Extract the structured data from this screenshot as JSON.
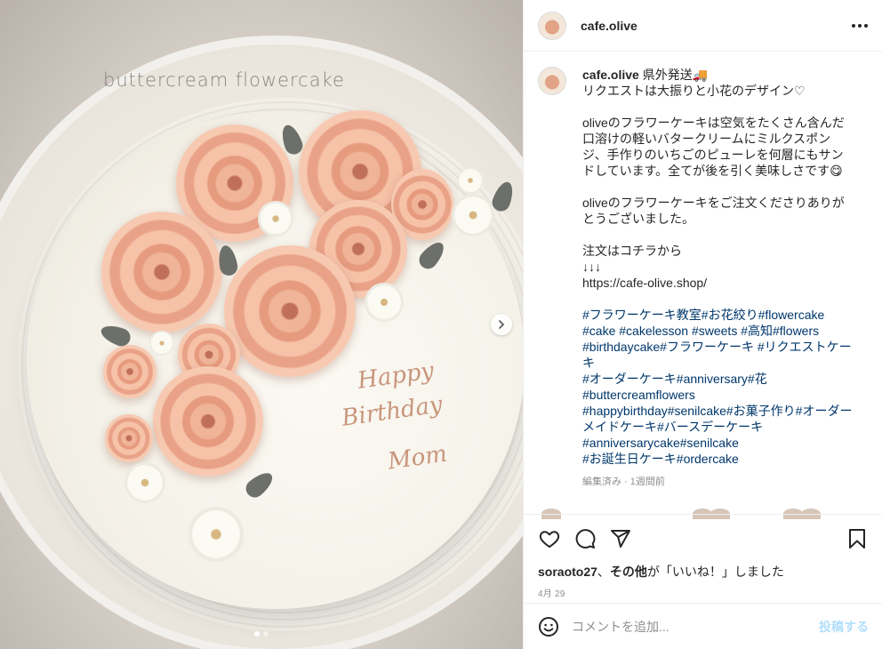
{
  "photo": {
    "watermark": "buttercream flowercake",
    "cake_text": [
      "Happy",
      "Birthday",
      "Mom"
    ]
  },
  "header": {
    "username": "cafe.olive"
  },
  "caption": {
    "author": "cafe.olive",
    "lines": [
      " 県外発送🚚",
      "リクエストは大振りと小花のデザイン♡",
      "",
      "oliveのフラワーケーキは空気をたくさん含んだ口溶けの軽いバタークリームにミルクスポンジ、手作りのいちごのピューレを何層にもサンドしています。全てが後を引く美味しさです😋",
      "",
      "oliveのフラワーケーキをご注文くださりありがとうございました。",
      "",
      "注文はコチラから",
      "↓↓↓",
      "https://cafe-olive.shop/",
      ""
    ],
    "hashtags": "#フラワーケーキ教室#お花絞り#flowercake\n#cake #cakelesson #sweets #高知#flowers\n#birthdaycake#フラワーケーキ #リクエストケーキ\n#オーダーケーキ#anniversary#花\n#buttercreamflowers\n#happybirthday#senilcake#お菓子作り#オーダーメイドケーキ#バースデーケーキ\n#anniversarycake#senilcake\n#お誕生日ケーキ#ordercake",
    "meta": "編集済み · 1週間前"
  },
  "likes": {
    "user": "soraoto27",
    "sep": "、",
    "others": "その他",
    "suffix": "が「いいね！」しました"
  },
  "date": "4月 29",
  "comment": {
    "placeholder": "コメントを追加...",
    "post_label": "投稿する"
  },
  "icons": [
    "heart-icon",
    "comment-icon",
    "share-icon",
    "bookmark-icon",
    "emoji-icon",
    "more-icon",
    "chevron-right-icon"
  ]
}
